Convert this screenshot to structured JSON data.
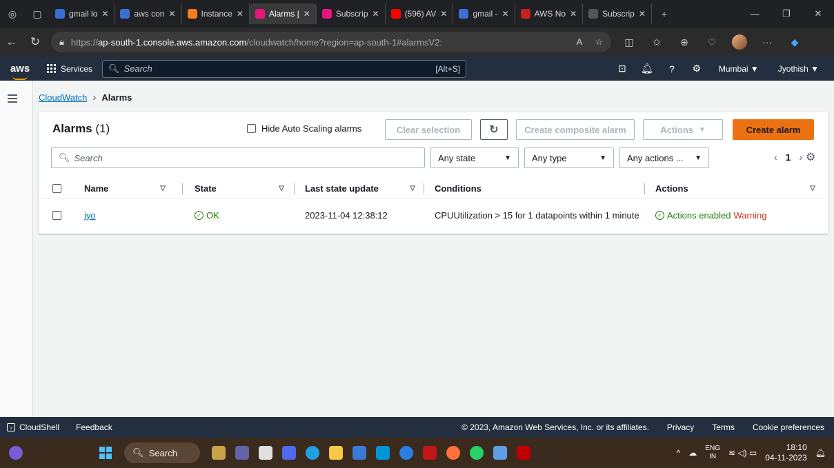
{
  "browser": {
    "tabs": [
      {
        "label": "gmail lo",
        "fav_color": "#3c6fd6",
        "active": false
      },
      {
        "label": "aws con",
        "fav_color": "#3c6fd6",
        "active": false
      },
      {
        "label": "Instance",
        "fav_color": "#f27d1a",
        "active": false
      },
      {
        "label": "Alarms |",
        "fav_color": "#e7157b",
        "active": true
      },
      {
        "label": "Subscrip",
        "fav_color": "#e7157b",
        "active": false
      },
      {
        "label": "(596) AV",
        "fav_color": "#ff0000",
        "active": false
      },
      {
        "label": "gmail -",
        "fav_color": "#3c6fd6",
        "active": false
      },
      {
        "label": "AWS No",
        "fav_color": "#c5221f",
        "active": false
      },
      {
        "label": "Subscrip",
        "fav_color": "#555555",
        "active": false
      }
    ],
    "url_prefix": "https://",
    "url_host": "ap-south-1.console.aws.amazon.com",
    "url_path": "/cloudwatch/home?region=ap-south-1#alarmsV2:"
  },
  "aws_nav": {
    "logo": "aws",
    "services": "Services",
    "search_placeholder": "Search",
    "search_shortcut": "[Alt+S]",
    "region": "Mumbai ▼",
    "user": "Jyothish ▼"
  },
  "breadcrumb": {
    "parent": "CloudWatch",
    "current": "Alarms"
  },
  "alarms": {
    "title": "Alarms",
    "count": "(1)",
    "hide_autoscaling": "Hide Auto Scaling alarms",
    "clear_selection": "Clear selection",
    "create_composite": "Create composite alarm",
    "actions": "Actions",
    "create_alarm": "Create alarm",
    "search_placeholder": "Search",
    "filters": {
      "state": "Any state",
      "type": "Any type",
      "actions": "Any actions ..."
    },
    "page": "1",
    "columns": [
      "Name",
      "State",
      "Last state update",
      "Conditions",
      "Actions"
    ],
    "rows": [
      {
        "name": "jyo",
        "state": "OK",
        "last_update": "2023-11-04 12:38:12",
        "condition": "CPUUtilization > 15 for 1 datapoints within 1 minute",
        "actions_enabled": "Actions enabled",
        "actions_warning": "Warning"
      }
    ]
  },
  "footer": {
    "cloudshell": "CloudShell",
    "feedback": "Feedback",
    "copyright": "© 2023, Amazon Web Services, Inc. or its affiliates.",
    "privacy": "Privacy",
    "terms": "Terms",
    "cookies": "Cookie preferences"
  },
  "taskbar": {
    "search": "Search",
    "lang_top": "ENG",
    "lang_bottom": "IN",
    "time": "18:10",
    "date": "04-11-2023"
  }
}
